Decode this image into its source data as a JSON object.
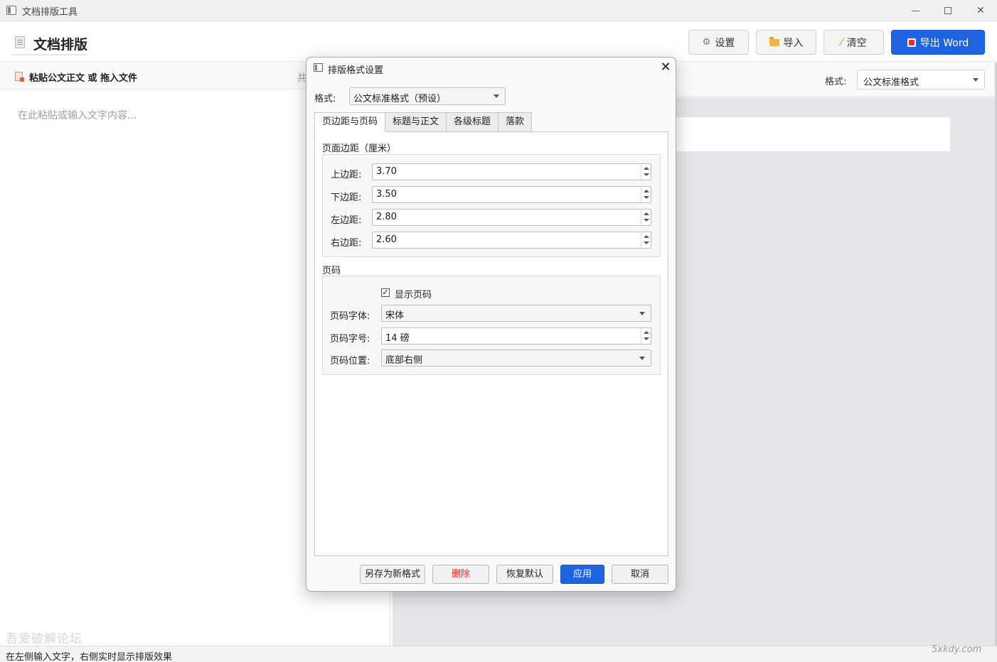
{
  "window": {
    "title": "文档排版工具"
  },
  "toolbar": {
    "heading": "文档排版",
    "settings_label": "设置",
    "import_label": "导入",
    "clear_label": "清空",
    "export_label": "导出 Word"
  },
  "left_panel": {
    "header_label": "粘贴公文正文 或 拖入文件",
    "count_text": "共",
    "placeholder": "在此粘贴或输入文字内容..."
  },
  "right_panel": {
    "format_label": "格式:",
    "format_value": "公文标准格式"
  },
  "statusbar": {
    "message": "在左侧输入文字，右侧实时显示排版效果"
  },
  "watermarks": {
    "left": "吾爱破解论坛",
    "right": "5xkdy.com"
  },
  "dialog": {
    "title": "排版格式设置",
    "format_label": "格式:",
    "format_value": "公文标准格式（预设）",
    "tabs": [
      "页边距与页码",
      "标题与正文",
      "各级标题",
      "落款"
    ],
    "active_tab": 0,
    "margins": {
      "group_title": "页面边距（厘米）",
      "top_label": "上边距:",
      "top_value": "3.70",
      "bottom_label": "下边距:",
      "bottom_value": "3.50",
      "left_label": "左边距:",
      "left_value": "2.80",
      "right_label": "右边距:",
      "right_value": "2.60"
    },
    "page_number": {
      "group_title": "页码",
      "show_label": "显示页码",
      "show_checked": true,
      "font_label": "页码字体:",
      "font_value": "宋体",
      "size_label": "页码字号:",
      "size_value": "14 磅",
      "position_label": "页码位置:",
      "position_value": "底部右侧"
    },
    "buttons": {
      "save_as": "另存为新格式",
      "delete": "删除",
      "restore": "恢复默认",
      "apply": "应用",
      "cancel": "取消"
    }
  },
  "colors": {
    "accent": "#1f63e0",
    "danger": "#d33333"
  },
  "icons": [
    "gear-icon",
    "folder-icon",
    "brush-icon",
    "word-icon",
    "document-icon",
    "paste-icon"
  ]
}
